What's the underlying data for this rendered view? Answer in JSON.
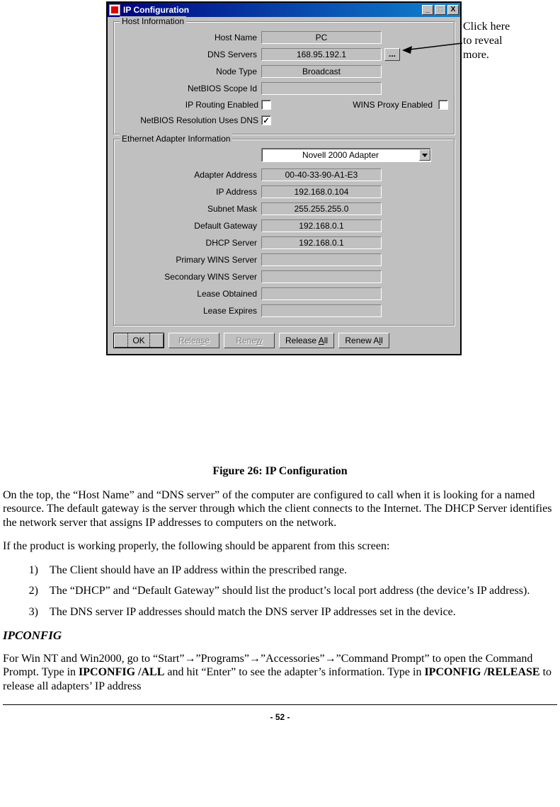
{
  "callout": {
    "line1": "Click here",
    "line2": "to reveal",
    "line3": "more."
  },
  "window": {
    "title": "IP Configuration",
    "buttons": {
      "minimize": "_",
      "maximize": "□",
      "close": "X"
    },
    "hostInfo": {
      "legend": "Host Information",
      "hostNameLabel": "Host Name",
      "hostName": "PC",
      "dnsServersLabel": "DNS Servers",
      "dnsServers": "168.95.192.1",
      "moreBtn": "...",
      "nodeTypeLabel": "Node Type",
      "nodeType": "Broadcast",
      "netbiosScopeLabel": "NetBIOS Scope Id",
      "netbiosScope": "",
      "ipRoutingLabel": "IP Routing Enabled",
      "winsProxyLabel": "WINS Proxy Enabled",
      "netbiosDnsLabel": "NetBIOS Resolution Uses DNS",
      "netbiosDnsChecked": "✓"
    },
    "adapterInfo": {
      "legend": "Ethernet  Adapter Information",
      "adapterSelected": "Novell 2000 Adapter",
      "adapterAddressLabel": "Adapter Address",
      "adapterAddress": "00-40-33-90-A1-E3",
      "ipAddressLabel": "IP Address",
      "ipAddress": "192.168.0.104",
      "subnetLabel": "Subnet Mask",
      "subnet": "255.255.255.0",
      "gatewayLabel": "Default Gateway",
      "gateway": "192.168.0.1",
      "dhcpLabel": "DHCP Server",
      "dhcp": "192.168.0.1",
      "pwinsLabel": "Primary WINS Server",
      "pwins": "",
      "swinsLabel": "Secondary WINS Server",
      "swins": "",
      "leaseObtLabel": "Lease Obtained",
      "leaseObt": "",
      "leaseExpLabel": "Lease Expires",
      "leaseExp": ""
    },
    "btnbar": {
      "ok": "OK",
      "release": "Release",
      "renew": "Renew",
      "releaseAll": "Release All",
      "renewAll": "Renew All"
    }
  },
  "doc": {
    "figCaption": "Figure 26: IP Configuration",
    "para1": "On the top, the “Host Name” and “DNS server” of the computer are configured to call when it is looking for a named resource. The default gateway is the server through which the client connects to the Internet. The DHCP Server identifies the network server that assigns IP addresses to computers on the network.",
    "para2": "If the product is working properly, the following should be apparent from this screen:",
    "item1": "The Client should have an IP address within the prescribed range.",
    "item2": " The “DHCP” and “Default Gateway” should list the product’s local port address (the device’s IP address).",
    "item3": "The DNS server IP addresses should match the DNS server IP addresses set in the device.",
    "heading": "IPCONFIG",
    "para3a": "For Win NT and Win2000, go to “Start”",
    "para3b": "”Programs”",
    "para3c": "”Accessories”",
    "para3d": "”Command Prompt” to open the Command Prompt. Type in ",
    "bold1": "IPCONFIG /ALL",
    "para3e": " and hit “Enter” to see the adapter’s information. Type in ",
    "bold2": "IPCONFIG /RELEASE",
    "para3f": " to release all adapters’ IP address",
    "arrow": "→",
    "pagenum": "- 52 -"
  }
}
